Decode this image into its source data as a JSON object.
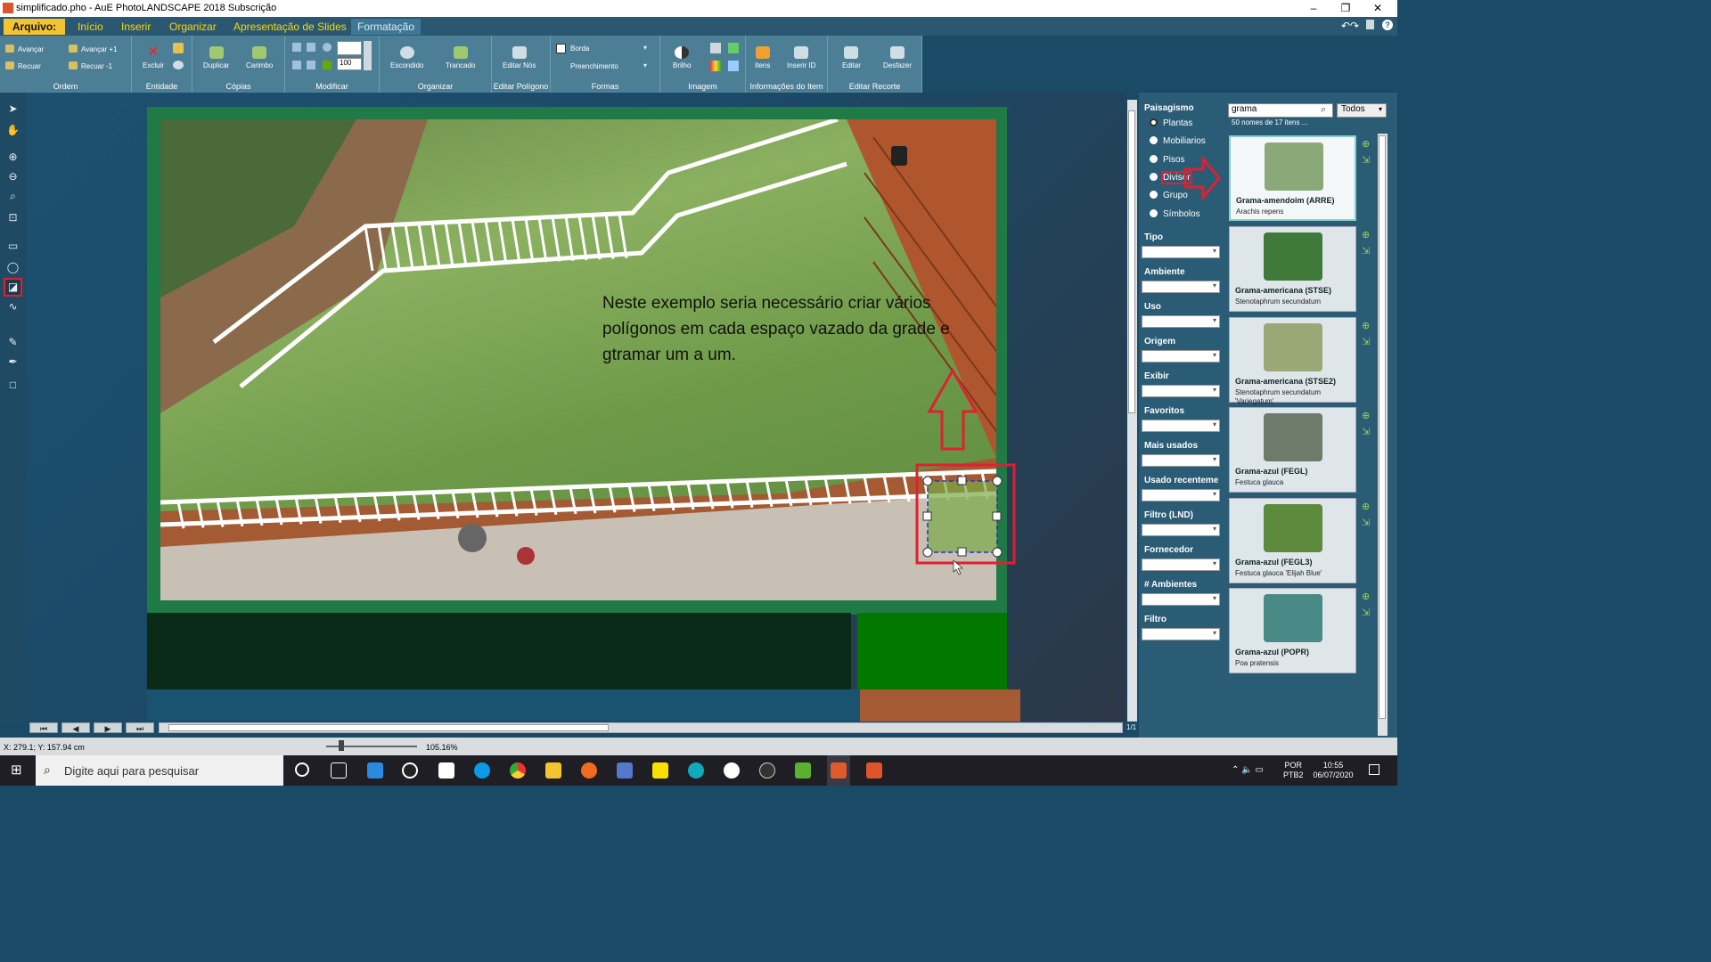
{
  "window": {
    "title": "simplificado.pho - AuE PhotoLANDSCAPE 2018 Subscrição",
    "controls": [
      "–",
      "❐",
      "✕"
    ]
  },
  "menu": {
    "file": "Arquivo:",
    "items": [
      "Início",
      "Inserir",
      "Organizar",
      "Apresentação de Slides",
      "Formatação"
    ]
  },
  "ribbon": {
    "ordem": {
      "label": "Ordem",
      "avancar": "Avançar",
      "recuar": "Recuar",
      "avancar1": "Avançar +1",
      "recuar1": "Recuar -1"
    },
    "entidade": {
      "label": "Entidade",
      "excluir": "Excluir"
    },
    "copias": {
      "label": "Cópias",
      "duplicar": "Duplicar",
      "carimbo": "Carimbo"
    },
    "modificar": {
      "label": "Modificar",
      "value": "100"
    },
    "organizar": {
      "label": "Organizar",
      "escondido": "Escondido",
      "trancado": "Trancado"
    },
    "poligono": {
      "label": "Editar Polígono",
      "editar_nos": "Editar Nós"
    },
    "formas": {
      "label": "Formas",
      "borda": "Borda",
      "preenchimento": "Preenchimento"
    },
    "imagem": {
      "label": "Imagem",
      "brilho": "Brilho"
    },
    "info": {
      "label": "Informações do Item",
      "itens": "Itens",
      "inserir_id": "Inserir ID"
    },
    "recorte": {
      "label": "Editar Recorte",
      "editar": "Editar",
      "desfazer": "Desfazer"
    }
  },
  "canvas": {
    "caption": "Neste exemplo seria necessário criar vários polígonos em cada espaço vazado da grade e gtramar um a um."
  },
  "panel": {
    "title": "Paisagismo",
    "search_value": "grama",
    "filter_all": "Todos",
    "count": "50 nomes de 17 itens ...",
    "categories": [
      "Plantas",
      "Mobiliarios",
      "Pisos",
      "Divisor",
      "Grupo",
      "Símbolos"
    ],
    "filters": [
      "Tipo",
      "Ambiente",
      "Uso",
      "Origem",
      "Exibir",
      "Favoritos",
      "Mais usados",
      "Usado recenteme",
      "Filtro (LND)",
      "Fornecedor",
      "# Ambientes",
      "Filtro"
    ],
    "items": [
      {
        "name": "Grama-amendoim (ARRE)",
        "species": "Arachis repens",
        "color": "#8aa878"
      },
      {
        "name": "Grama-americana (STSE)",
        "species": "Stenotaphrum secundatum",
        "color": "#3f7a3a"
      },
      {
        "name": "Grama-americana (STSE2)",
        "species": "Stenotaphrum secundatum 'Variegatum'",
        "color": "#9aa878"
      },
      {
        "name": "Grama-azul (FEGL)",
        "species": "Festuca glauca",
        "color": "#6e7a6a"
      },
      {
        "name": "Grama-azul (FEGL3)",
        "species": "Festuca glauca 'Elijah Blue'",
        "color": "#5e8a3e"
      },
      {
        "name": "Grama-azul (POPR)",
        "species": "Poa pratensis",
        "color": "#4a8a86"
      }
    ]
  },
  "status": {
    "coords": "X: 279.1; Y: 157.94 cm",
    "zoom": "105.16%",
    "page": "1/1"
  },
  "taskbar": {
    "search_placeholder": "Digite aqui para pesquisar",
    "lang": "POR",
    "layout": "PTB2",
    "time": "10:55",
    "date": "06/07/2020"
  }
}
